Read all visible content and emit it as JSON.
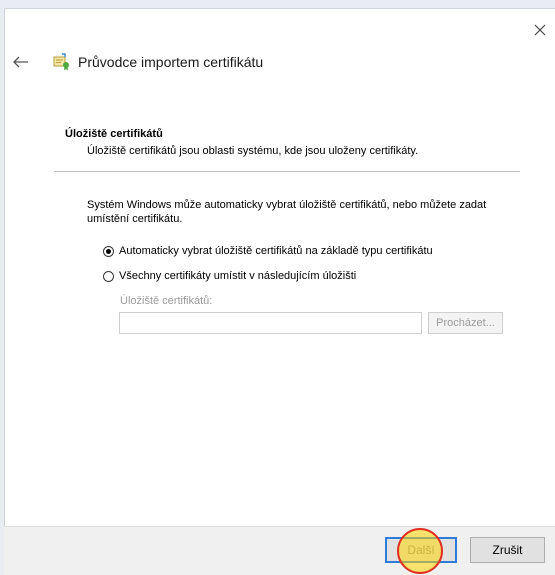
{
  "wizard": {
    "title": "Průvodce importem certifikátu",
    "icons": {
      "back": "back-arrow-icon",
      "close": "close-icon",
      "wizard": "certificate-wizard-icon"
    }
  },
  "section": {
    "heading": "Úložiště certifikátů",
    "description": "Úložiště certifikátů jsou oblasti systému, kde jsou uloženy certifikáty."
  },
  "content": {
    "info": "Systém Windows může automaticky vybrat úložiště certifikátů, nebo můžete zadat umístění certifikátu.",
    "options": [
      {
        "label": "Automaticky vybrat úložiště certifikátů na základě typu certifikátu",
        "selected": true
      },
      {
        "label": "Všechny certifikáty umístit v následujícím úložišti",
        "selected": false
      }
    ],
    "store_label": "Úložiště certifikátů:",
    "store_value": "",
    "browse_label": "Procházet..."
  },
  "footer": {
    "next_label": "Další",
    "cancel_label": "Zrušit"
  },
  "colors": {
    "accent": "#2f7bd9",
    "highlight": "#ffd600",
    "highlight_border": "#e03020"
  }
}
